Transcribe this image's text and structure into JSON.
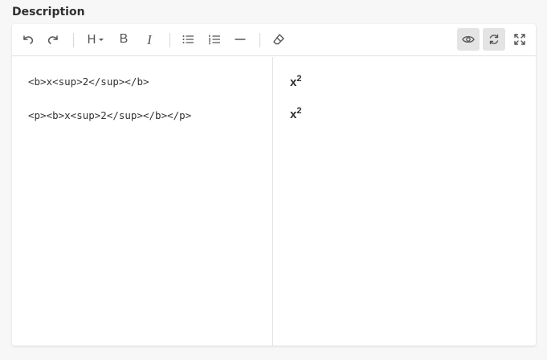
{
  "field": {
    "label": "Description"
  },
  "toolbar": {
    "undo_icon": "undo-icon",
    "redo_icon": "redo-icon",
    "heading_label": "H",
    "bold_label": "B",
    "italic_label": "I",
    "bullet_list_icon": "bullet-list-icon",
    "numbered_list_icon": "numbered-list-icon",
    "rule_icon": "horizontal-rule-icon",
    "clear_icon": "eraser-icon",
    "preview_icon": "eye-icon",
    "sync_icon": "sync-icon",
    "fullscreen_icon": "fullscreen-icon"
  },
  "source": {
    "lines": [
      "<b>x<sup>2</sup></b>",
      "<p><b>x<sup>2</sup></b></p>"
    ]
  },
  "preview": {
    "lines": [
      {
        "base": "x",
        "sup": "2"
      },
      {
        "base": "x",
        "sup": "2"
      }
    ]
  }
}
